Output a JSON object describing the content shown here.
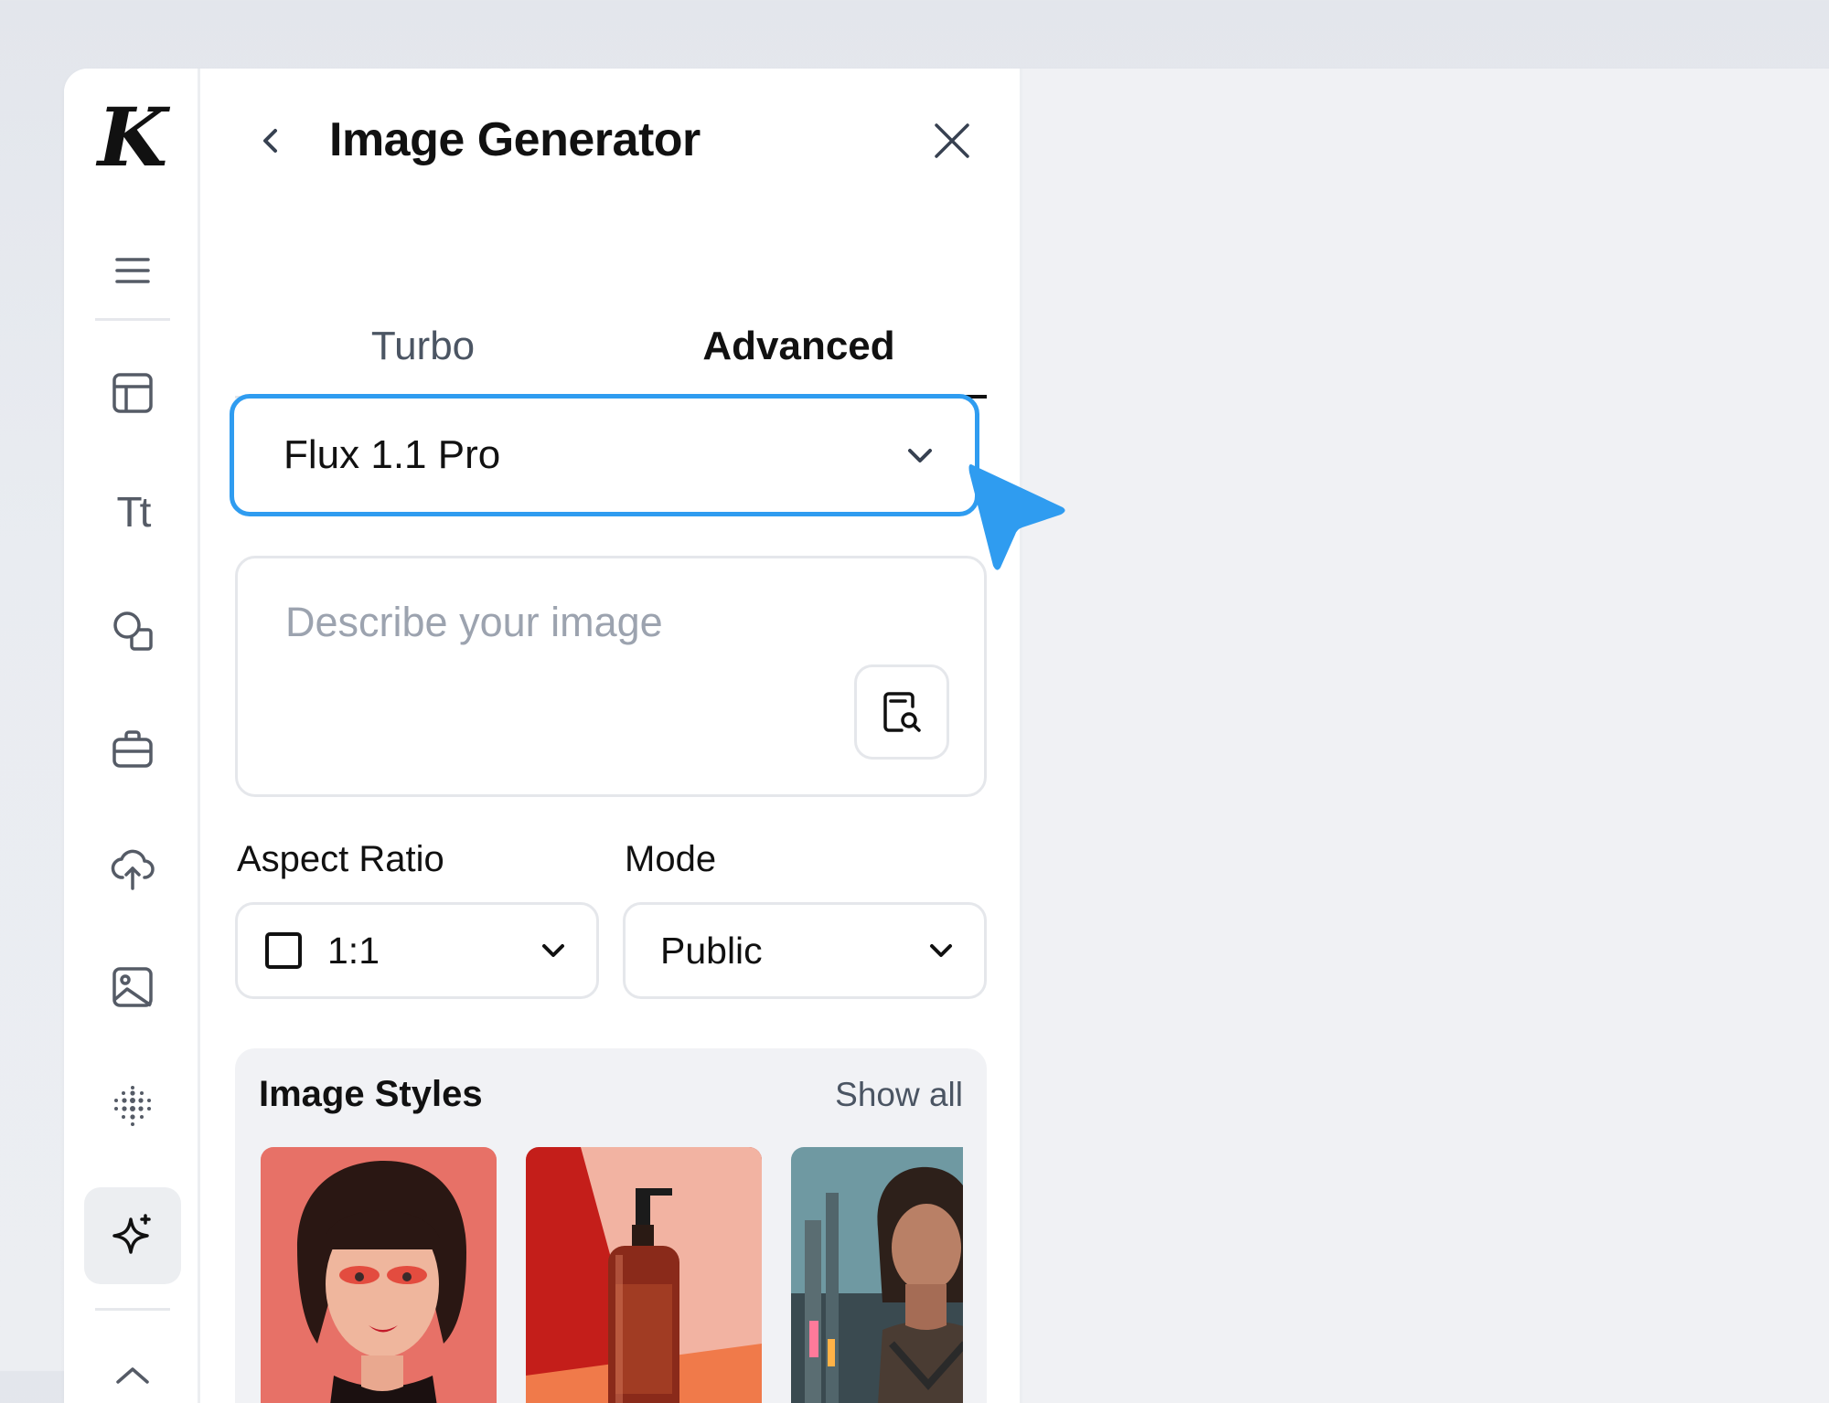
{
  "app": {
    "logo_text": "K"
  },
  "rail": {
    "items": [
      {
        "name": "menu",
        "icon": "hamburger-icon"
      },
      {
        "name": "templates",
        "icon": "layout-icon"
      },
      {
        "name": "text",
        "icon": "text-icon",
        "glyph": "Tt"
      },
      {
        "name": "elements",
        "icon": "shapes-icon"
      },
      {
        "name": "brand",
        "icon": "briefcase-icon"
      },
      {
        "name": "uploads",
        "icon": "cloud-upload-icon"
      },
      {
        "name": "photos",
        "icon": "image-icon"
      },
      {
        "name": "patterns",
        "icon": "dots-grid-icon"
      },
      {
        "name": "ai-generator",
        "icon": "sparkle-icon",
        "active": true
      }
    ]
  },
  "panel": {
    "title": "Image Generator",
    "tabs": [
      {
        "label": "Turbo",
        "active": false
      },
      {
        "label": "Advanced",
        "active": true
      }
    ],
    "model_select": {
      "value": "Flux 1.1 Pro",
      "accent": "#2f9cf0"
    },
    "prompt": {
      "placeholder": "Describe your image",
      "value": ""
    },
    "aspect_ratio": {
      "label": "Aspect Ratio",
      "value": "1:1"
    },
    "mode": {
      "label": "Mode",
      "value": "Public"
    },
    "styles": {
      "title": "Image Styles",
      "show_all": "Show all",
      "items": [
        {
          "name": "portrait-red-makeup"
        },
        {
          "name": "product-bottle"
        },
        {
          "name": "cyberpunk-warrior"
        }
      ]
    }
  },
  "colors": {
    "accent": "#2f9cf0",
    "text": "#111827",
    "muted": "#9ca3af",
    "border": "#e5e7eb"
  }
}
